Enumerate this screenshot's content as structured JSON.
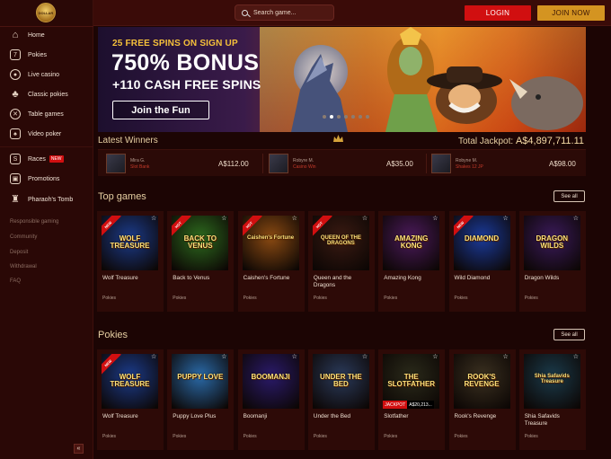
{
  "header": {
    "search_placeholder": "Search game...",
    "login_label": "LOGIN",
    "join_label": "JOIN NOW",
    "logo_text": "DOLLAR"
  },
  "sidebar": {
    "items": [
      {
        "label": "Home",
        "icon": "home-icon"
      },
      {
        "label": "Pokies",
        "icon": "pokies-icon"
      },
      {
        "label": "Live casino",
        "icon": "live-casino-icon"
      },
      {
        "label": "Classic pokies",
        "icon": "classic-pokies-icon"
      },
      {
        "label": "Table games",
        "icon": "table-games-icon"
      },
      {
        "label": "Video poker",
        "icon": "video-poker-icon"
      },
      {
        "label": "Races",
        "icon": "races-icon",
        "badge": "NEW"
      },
      {
        "label": "Promotions",
        "icon": "gift-icon"
      },
      {
        "label": "Pharaoh's Tomb",
        "icon": "pharaoh-icon"
      }
    ],
    "sub_links": [
      "Responsible gaming",
      "Community",
      "Deposit",
      "Withdrawal",
      "FAQ"
    ],
    "collapse_label": "«"
  },
  "banner": {
    "line1": "25 FREE SPINS ON SIGN UP",
    "line2": "750% BONUS",
    "line3": "+110 CASH FREE SPINS",
    "cta": "Join the Fun",
    "slides": 7,
    "active_slide": 1
  },
  "winners": {
    "title": "Latest Winners",
    "jackpot_label": "Total Jackpot:",
    "jackpot_value": "A$4,897,711.11",
    "list": [
      {
        "name": "Mira G.",
        "game": "Slot Bank",
        "amount": "A$112.00"
      },
      {
        "name": "Robyre M.",
        "game": "Casino Win",
        "amount": "A$35.00"
      },
      {
        "name": "Robyne M.",
        "game": "Shakes 12 JP",
        "amount": "A$98.00"
      }
    ]
  },
  "top_games": {
    "title": "Top games",
    "see_all": "See all",
    "games": [
      {
        "title": "Wolf Treasure",
        "category": "Pokies",
        "art_text": "WOLF TREASURE",
        "ribbon": "NEW",
        "bg": "#1b3b8a"
      },
      {
        "title": "Back to Venus",
        "category": "Pokies",
        "art_text": "BACK TO VENUS",
        "ribbon": "HOT",
        "bg": "#2d6a1e"
      },
      {
        "title": "Caishen's Fortune",
        "category": "Pokies",
        "art_text": "Caishen's Fortune",
        "ribbon": "HOT",
        "bg": "#8a4a12"
      },
      {
        "title": "Queen and the Dragons",
        "category": "Pokies",
        "art_text": "QUEEN OF THE DRAGONS",
        "ribbon": "HOT",
        "bg": "#3a1a12"
      },
      {
        "title": "Amazing Kong",
        "category": "Pokies",
        "art_text": "AMAZING KONG",
        "ribbon": "",
        "bg": "#4a1a5a"
      },
      {
        "title": "Wild Diamond",
        "category": "Pokies",
        "art_text": "DIAMOND",
        "ribbon": "NEW",
        "bg": "#1a3a9a"
      },
      {
        "title": "Dragon Wilds",
        "category": "Pokies",
        "art_text": "DRAGON WILDS",
        "ribbon": "",
        "bg": "#3a1a5a"
      }
    ]
  },
  "pokies": {
    "title": "Pokies",
    "see_all": "See all",
    "games": [
      {
        "title": "Wolf Treasure",
        "category": "Pokies",
        "art_text": "WOLF TREASURE",
        "ribbon": "NEW",
        "bg": "#1b3b8a"
      },
      {
        "title": "Puppy Love Plus",
        "category": "Pokies",
        "art_text": "PUPPY LOVE",
        "ribbon": "",
        "bg": "#2a6aa8"
      },
      {
        "title": "Boomanji",
        "category": "Pokies",
        "art_text": "BOOMANJI",
        "ribbon": "",
        "bg": "#2a1a6a"
      },
      {
        "title": "Under the Bed",
        "category": "Pokies",
        "art_text": "UNDER THE BED",
        "ribbon": "",
        "bg": "#2a3a5a"
      },
      {
        "title": "Slotfather",
        "category": "Pokies",
        "art_text": "THE SLOTFATHER",
        "ribbon": "",
        "bg": "#2a2a1a",
        "jackpot_tag": "JACKPOT",
        "jackpot_amount": "A$20,213..."
      },
      {
        "title": "Rook's Revenge",
        "category": "Pokies",
        "art_text": "ROOK'S REVENGE",
        "ribbon": "",
        "bg": "#3a3020"
      },
      {
        "title": "Shia Safavids Treasure",
        "category": "Pokies",
        "art_text": "Shia Safavids Treasure",
        "ribbon": "",
        "bg": "#1a3a4a"
      }
    ]
  }
}
